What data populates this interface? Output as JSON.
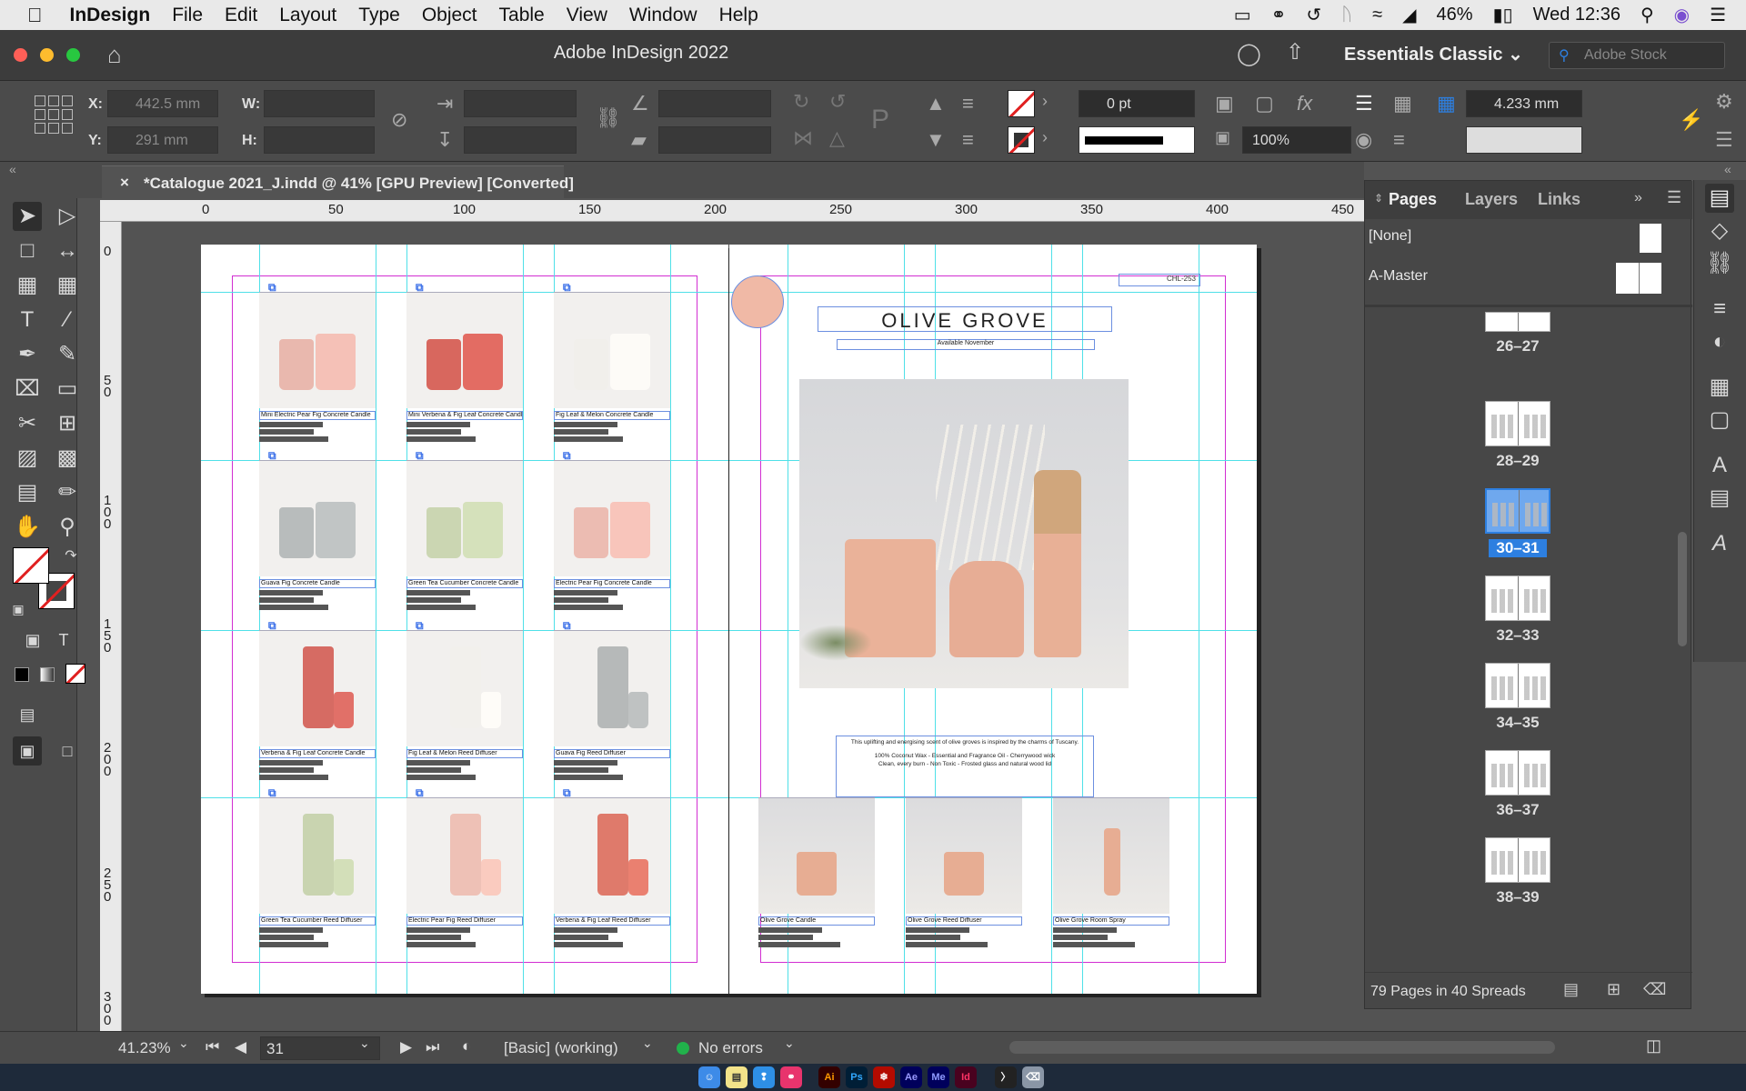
{
  "menubar": {
    "app": "InDesign",
    "items": [
      "File",
      "Edit",
      "Layout",
      "Type",
      "Object",
      "Table",
      "View",
      "Window",
      "Help"
    ],
    "battery": "46%",
    "clock": "Wed 12:36"
  },
  "window": {
    "title": "Adobe InDesign 2022",
    "workspace": "Essentials Classic",
    "stock_placeholder": "Adobe Stock"
  },
  "control": {
    "x_label": "X:",
    "x_value": "442.5 mm",
    "y_label": "Y:",
    "y_value": "291 mm",
    "w_label": "W:",
    "h_label": "H:",
    "stroke_weight": "0 pt",
    "opacity": "100%",
    "gutter": "4.233 mm"
  },
  "document": {
    "tab_label": "*Catalogue 2021_J.indd @ 41% [GPU Preview] [Converted]"
  },
  "ruler": {
    "h_ticks": [
      "0",
      "50",
      "100",
      "150",
      "200",
      "250",
      "300",
      "350",
      "400",
      "450"
    ],
    "v_ticks": [
      "0",
      "50",
      "100",
      "150",
      "200",
      "250",
      "300"
    ]
  },
  "left_page": {
    "products": [
      {
        "name": "Mini Electric Pear Fig Concrete Candle",
        "color": "#e9b8ae"
      },
      {
        "name": "Mini Verbena & Fig Leaf Concrete Candle",
        "color": "#d8675e"
      },
      {
        "name": "Fig Leaf & Melon Concrete Candle",
        "color": "#f1efeb"
      },
      {
        "name": "Guava Fig Concrete Candle",
        "color": "#b8bcbc"
      },
      {
        "name": "Green Tea Cucumber Concrete Candle",
        "color": "#cbd6b2"
      },
      {
        "name": "Electric Pear Fig Concrete Candle",
        "color": "#ecbcb2"
      },
      {
        "name": "Verbena & Fig Leaf Concrete Candle",
        "color": "#d66b63"
      },
      {
        "name": "Fig Leaf & Melon Reed Diffuser",
        "color": "#f2f0ec"
      },
      {
        "name": "Guava Fig Reed Diffuser",
        "color": "#b6b9b9"
      },
      {
        "name": "Green Tea Cucumber Reed Diffuser",
        "color": "#c9d4b0"
      },
      {
        "name": "Electric Pear Fig Reed Diffuser",
        "color": "#eec1b6"
      },
      {
        "name": "Verbena & Fig Leaf Reed Diffuser",
        "color": "#df7a6b"
      }
    ]
  },
  "right_page": {
    "code": "CHL-253",
    "title": "OLIVE GROVE",
    "subtitle": "Available November",
    "body_line1": "This uplifting and energising scent of olive groves is inspired by the charms of Tuscany.",
    "body_line2": "100% Coconut Wax - Essential and Fragrance Oil - Cherrywood wick",
    "body_line3": "Clean, every burn - Non Toxic - Frosted glass and natural wood lid",
    "products": [
      {
        "name": "Olive Grove Candle"
      },
      {
        "name": "Olive Grove Reed Diffuser"
      },
      {
        "name": "Olive Grove Room Spray"
      }
    ]
  },
  "pages_panel": {
    "tabs": [
      "Pages",
      "Layers",
      "Links"
    ],
    "none_label": "[None]",
    "master_label": "A-Master",
    "spreads": [
      {
        "label": "26–27"
      },
      {
        "label": "28–29"
      },
      {
        "label": "30–31",
        "selected": true
      },
      {
        "label": "32–33"
      },
      {
        "label": "34–35"
      },
      {
        "label": "36–37"
      },
      {
        "label": "38–39"
      }
    ],
    "footer": "79 Pages in 40 Spreads"
  },
  "status": {
    "zoom": "41.23%",
    "page": "31",
    "style": "[Basic] (working)",
    "preflight": "No errors"
  },
  "dock": {
    "apps": [
      "Ai",
      "Ps",
      "Ae",
      "Me",
      "Id"
    ]
  },
  "colors": {
    "accent": "#2d7fe0",
    "margin": "#d22ed2",
    "guide": "#4fe0e8",
    "ok": "#21b24b"
  }
}
